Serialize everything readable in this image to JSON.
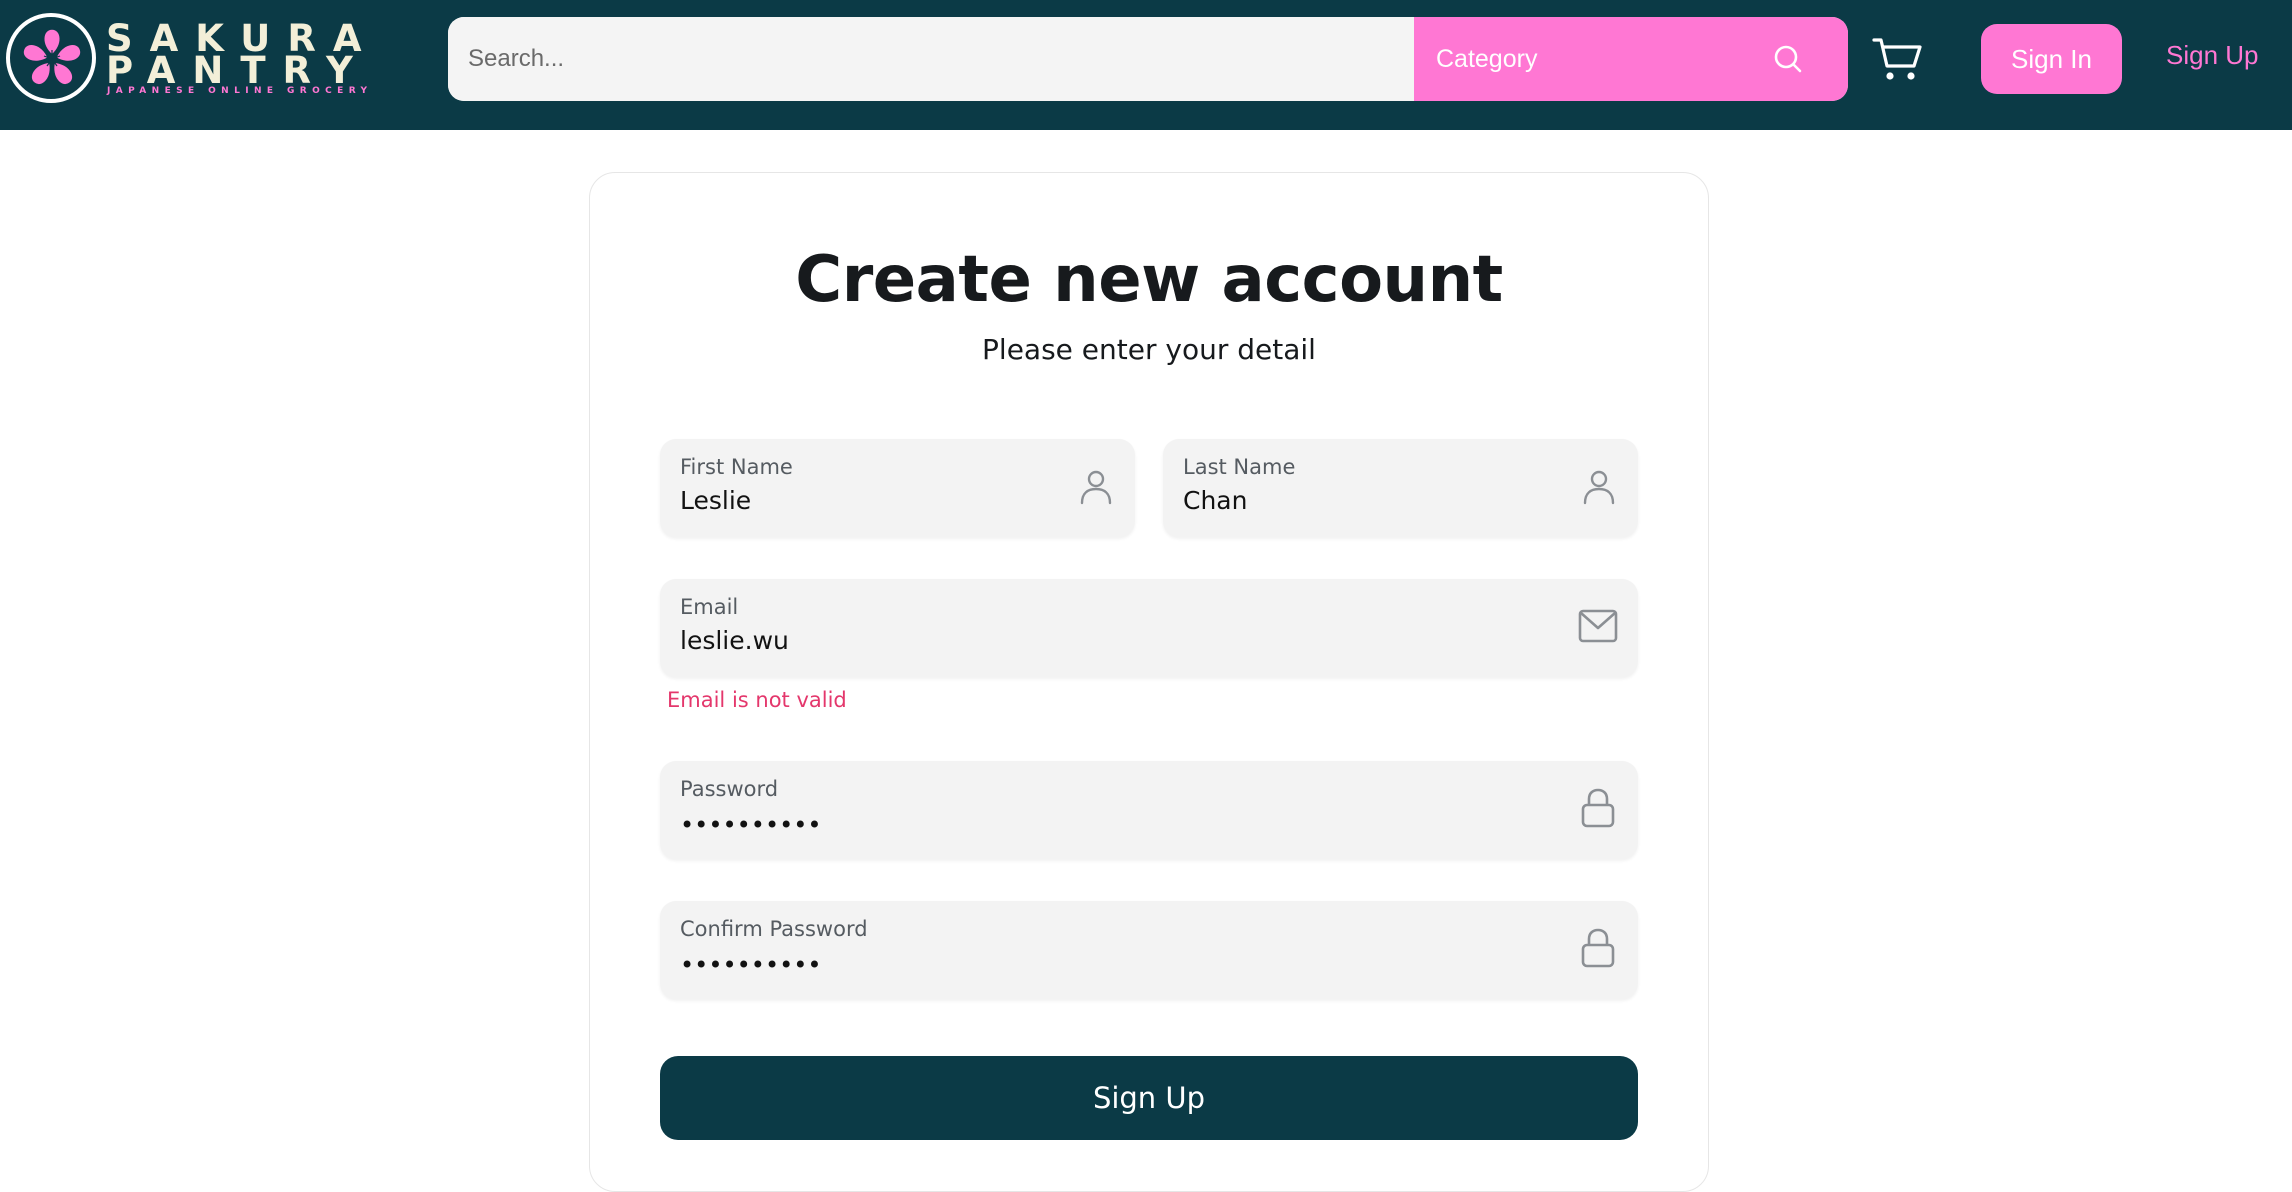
{
  "brand": {
    "name_line1": "SAKURA",
    "name_line2": "PANTRY",
    "tagline": "JAPANESE ONLINE GROCERY",
    "logo_icon": "sakura-flower-icon"
  },
  "header": {
    "search_placeholder": "Search...",
    "category_label": "Category",
    "sign_in": "Sign In",
    "sign_up_link": "Sign Up"
  },
  "form": {
    "title": "Create new account",
    "subtitle": "Please enter your detail",
    "first_name": {
      "label": "First Name",
      "value": "Leslie",
      "icon": "user-icon"
    },
    "last_name": {
      "label": "Last Name",
      "value": "Chan",
      "icon": "user-icon"
    },
    "email": {
      "label": "Email",
      "value": "leslie.wu",
      "icon": "mail-icon",
      "error": "Email is not valid"
    },
    "password": {
      "label": "Password",
      "masked": "••••••••••",
      "icon": "lock-icon"
    },
    "confirm_password": {
      "label": "Confirm Password",
      "masked": "••••••••••",
      "icon": "lock-icon"
    },
    "submit": "Sign Up"
  },
  "colors": {
    "header_bg": "#0b3a46",
    "accent_pink": "#ff77d3",
    "field_bg": "#f3f3f3",
    "error": "#e4376c",
    "button_bg": "#0b3a46"
  }
}
